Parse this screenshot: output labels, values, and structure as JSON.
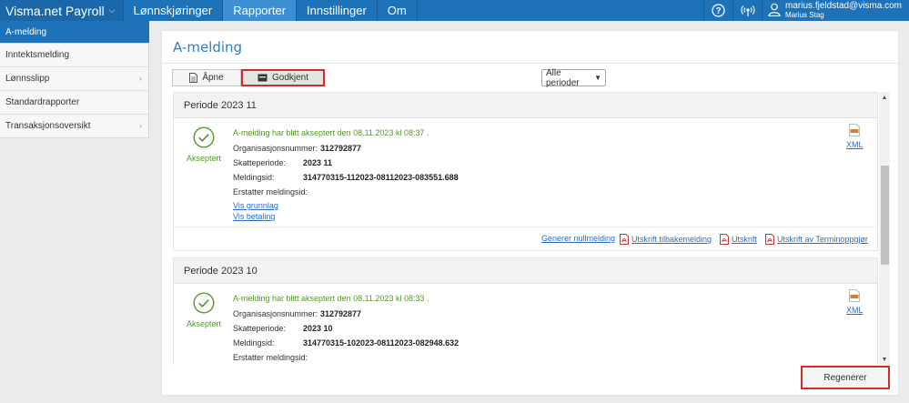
{
  "app": {
    "brand": "Visma.net Payroll"
  },
  "nav": {
    "items": [
      "Lønnskjøringer",
      "Rapporter",
      "Innstillinger",
      "Om"
    ],
    "active": "Rapporter"
  },
  "user": {
    "email": "marius.fjeldstad@visma.com",
    "name": "Marius Stag"
  },
  "sidebar": {
    "items": [
      {
        "label": "A-melding",
        "active": true
      },
      {
        "label": "Inntektsmelding"
      },
      {
        "label": "Lønnsslipp",
        "has_arrow": true
      },
      {
        "label": "Standardrapporter"
      },
      {
        "label": "Transaksjonsoversikt",
        "has_arrow": true
      }
    ]
  },
  "page": {
    "title": "A-melding"
  },
  "tabs": {
    "apne": "Åpne",
    "godkjent": "Godkjent"
  },
  "filter": {
    "selected": "Alle perioder"
  },
  "periods": [
    {
      "header": "Periode 2023 11",
      "status": "Akseptert",
      "message": "A-melding har blitt akseptert den 08.11.2023 kl 08:37 .",
      "org_label": "Organisasjonsnummer:",
      "org_value": "312792877",
      "skatt_label": "Skatteperiode:",
      "skatt_value": "2023 11",
      "meld_label": "Meldingsid:",
      "meld_value": "314770315-112023-08112023-083551.688",
      "erst_label": "Erstatter meldingsid:",
      "link_grunnlag": "Vis grunnlag",
      "link_betaling": "Vis betaling",
      "xml": "XML",
      "actions": {
        "nullmelding": "Generer nullmelding",
        "tilbakemelding": "Utskrift tilbakemelding",
        "utskrift": "Utskrift",
        "terminoppgjor": "Utskrift av Terminoppgjør"
      }
    },
    {
      "header": "Periode 2023 10",
      "status": "Akseptert",
      "message": "A-melding har blitt akseptert den 08.11.2023 kl 08:33 .",
      "org_label": "Organisasjonsnummer:",
      "org_value": "312792877",
      "skatt_label": "Skatteperiode:",
      "skatt_value": "2023 10",
      "meld_label": "Meldingsid:",
      "meld_value": "314770315-102023-08112023-082948.632",
      "erst_label": "Erstatter meldingsid:",
      "xml": "XML"
    }
  ],
  "regenerate": "Regenerer",
  "colors": {
    "accent": "#1d72b8",
    "success": "#55982b",
    "highlight": "#d42a2a",
    "link": "#2a6ebd"
  },
  "icons": [
    "help-icon",
    "broadcast-icon",
    "user-icon",
    "document-icon",
    "inbox-icon",
    "check-circle-icon",
    "xml-file-icon",
    "pdf-icon"
  ]
}
